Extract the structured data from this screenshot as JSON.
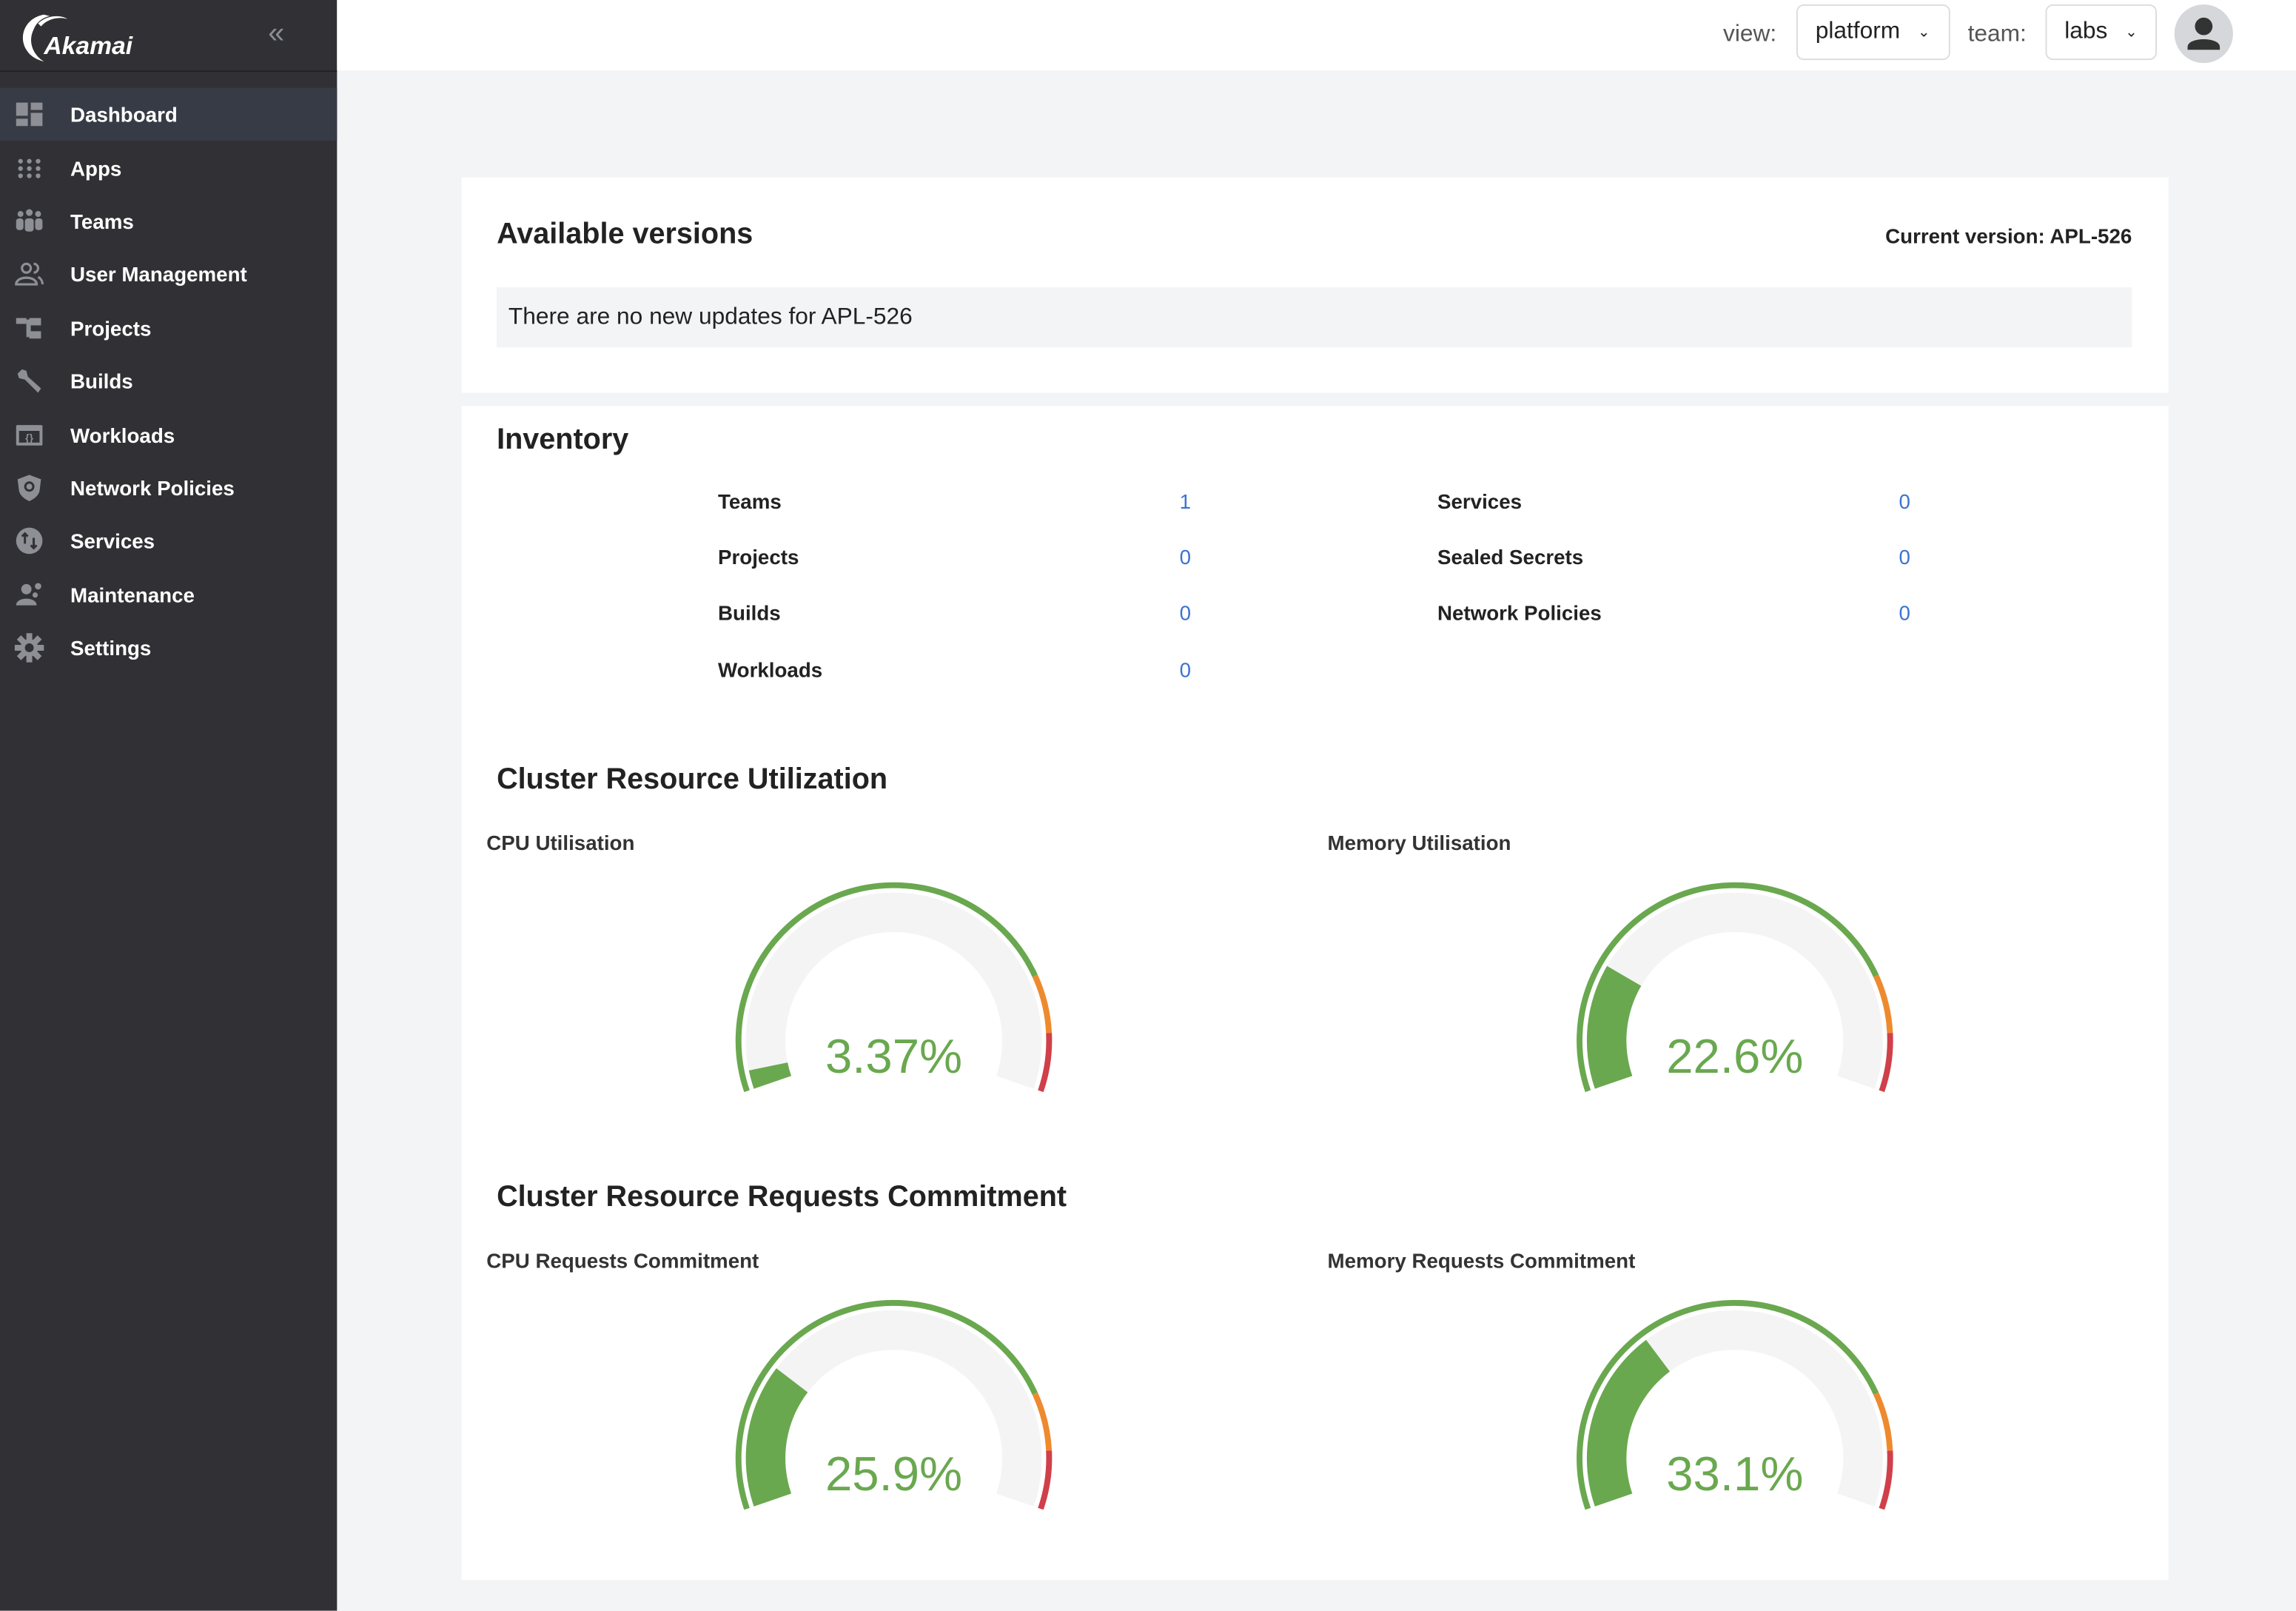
{
  "brand": {
    "logo_text": "Akamai"
  },
  "sidebar": {
    "items": [
      {
        "label": "Dashboard",
        "icon": "dashboard-icon",
        "active": true
      },
      {
        "label": "Apps",
        "icon": "apps-grid-icon"
      },
      {
        "label": "Teams",
        "icon": "teams-icon"
      },
      {
        "label": "User Management",
        "icon": "users-icon"
      },
      {
        "label": "Projects",
        "icon": "projects-icon"
      },
      {
        "label": "Builds",
        "icon": "wrench-icon"
      },
      {
        "label": "Workloads",
        "icon": "workloads-icon"
      },
      {
        "label": "Network Policies",
        "icon": "shield-icon"
      },
      {
        "label": "Services",
        "icon": "services-icon"
      },
      {
        "label": "Maintenance",
        "icon": "maintenance-icon"
      },
      {
        "label": "Settings",
        "icon": "gear-icon"
      }
    ]
  },
  "header": {
    "view_label": "view:",
    "view_value": "platform",
    "team_label": "team:",
    "team_value": "labs"
  },
  "versions": {
    "title": "Available versions",
    "current": "Current version: APL-526",
    "message": "There are no new updates for APL-526"
  },
  "inventory": {
    "title": "Inventory",
    "left": [
      {
        "label": "Teams",
        "value": "1"
      },
      {
        "label": "Projects",
        "value": "0"
      },
      {
        "label": "Builds",
        "value": "0"
      },
      {
        "label": "Workloads",
        "value": "0"
      }
    ],
    "right": [
      {
        "label": "Services",
        "value": "0"
      },
      {
        "label": "Sealed Secrets",
        "value": "0"
      },
      {
        "label": "Network Policies",
        "value": "0"
      }
    ]
  },
  "utilization": {
    "title": "Cluster Resource Utilization",
    "cpu": {
      "label": "CPU Utilisation",
      "value": 3.37,
      "text": "3.37%"
    },
    "memory": {
      "label": "Memory Utilisation",
      "value": 22.6,
      "text": "22.6%"
    }
  },
  "commitment": {
    "title": "Cluster Resource Requests Commitment",
    "cpu": {
      "label": "CPU Requests Commitment",
      "value": 25.9,
      "text": "25.9%"
    },
    "memory": {
      "label": "Memory Requests Commitment",
      "value": 33.1,
      "text": "33.1%"
    }
  },
  "gauge_thresholds": {
    "green_to": 80,
    "orange_to": 90,
    "red_to": 100
  },
  "colors": {
    "green": "#6aa84f",
    "orange": "#ee8a2e",
    "red": "#d0404a",
    "track": "#f4f4f4",
    "sidebar": "#313135",
    "link": "#3a73d0"
  }
}
